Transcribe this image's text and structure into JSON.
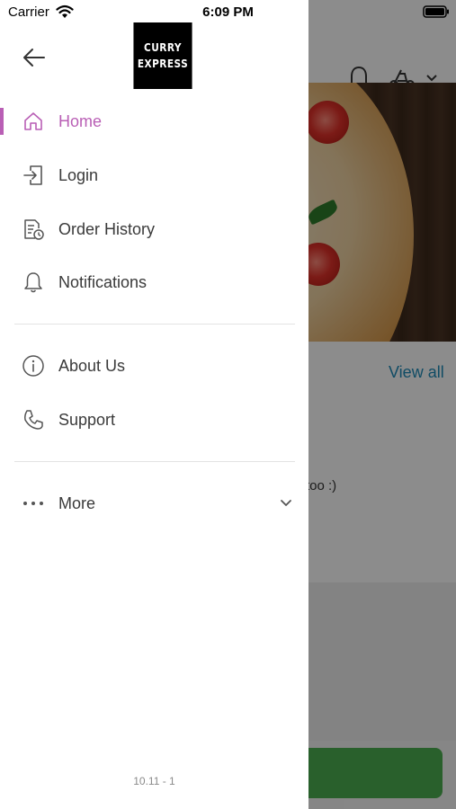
{
  "status_bar": {
    "carrier": "Carrier",
    "time": "6:09 PM"
  },
  "drawer": {
    "logo": {
      "line1": "CURRY",
      "line2": "EXPRESS"
    },
    "menu": [
      {
        "label": "Home",
        "icon": "home-icon",
        "active": true
      },
      {
        "label": "Login",
        "icon": "login-icon",
        "active": false
      },
      {
        "label": "Order History",
        "icon": "order-history-icon",
        "active": false
      },
      {
        "label": "Notifications",
        "icon": "bell-icon",
        "active": false
      },
      {
        "label": "About Us",
        "icon": "info-icon",
        "active": false
      },
      {
        "label": "Support",
        "icon": "phone-icon",
        "active": false
      },
      {
        "label": "More",
        "icon": "more-dots-icon",
        "active": false
      }
    ],
    "version": "10.11 - 1"
  },
  "background": {
    "view_all": "View all",
    "snippet": "too :)"
  },
  "colors": {
    "accent": "#b95fb5",
    "link": "#1e8ab8",
    "cta_green": "#4caf50"
  }
}
